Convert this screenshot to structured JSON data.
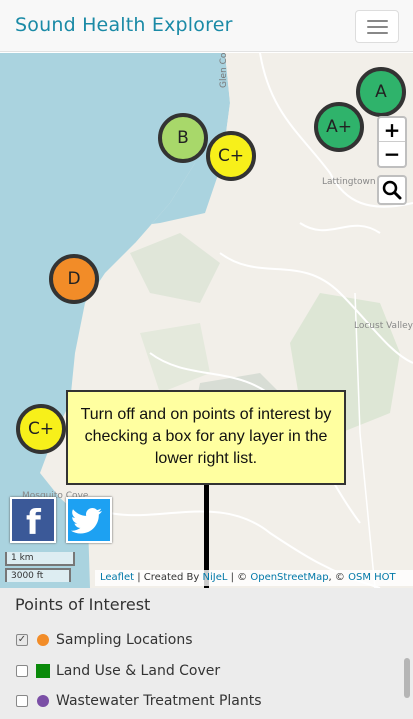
{
  "navbar": {
    "brand": "Sound Health Explorer",
    "menu_icon": "hamburger-icon"
  },
  "map": {
    "road_label": "Glen Cove",
    "place_labels": [
      "Lattingtown",
      "Locust Valley",
      "Mosquito Cove"
    ],
    "markers": [
      {
        "grade": "B",
        "color": "#a8d86a"
      },
      {
        "grade": "C+",
        "color": "#f7f01a"
      },
      {
        "grade": "A+",
        "color": "#2fb36b"
      },
      {
        "grade": "A",
        "color": "#2fb36b"
      },
      {
        "grade": "D",
        "color": "#f28c28"
      },
      {
        "grade": "C+",
        "color": "#f7f01a"
      }
    ],
    "zoom_in": "+",
    "zoom_out": "−",
    "search_icon": "search-icon",
    "tooltip": "Turn off and on points of interest by checking a box for any layer in the lower right list.",
    "share": {
      "facebook_label": "f",
      "twitter_icon": "twitter-bird-icon"
    },
    "scale": {
      "metric": "1 km",
      "imperial": "3000 ft"
    },
    "attribution": {
      "leaflet": "Leaflet",
      "created_by": " | Created By ",
      "author": "NiJeL",
      "sep1": " | © ",
      "osm": "OpenStreetMap",
      "sep2": ", © ",
      "osm_hot": "OSM HOT"
    }
  },
  "panel": {
    "title": "Points of Interest",
    "items": [
      {
        "label": "Sampling Locations",
        "checked": "✓",
        "swatch_color": "#f28c28"
      },
      {
        "label": "Land Use & Land Cover",
        "checked": "",
        "swatch_color": "#0a8a0a"
      },
      {
        "label": "Wastewater Treatment Plants",
        "checked": "",
        "swatch_color": "#7b4fa6"
      }
    ]
  },
  "colors": {
    "brand": "#1a8aa6",
    "water": "#aad3df",
    "land": "#f2efe9",
    "tooltip_bg": "#ffffa0"
  }
}
